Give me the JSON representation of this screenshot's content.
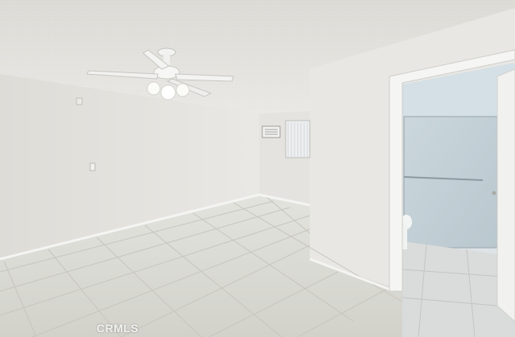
{
  "photo": {
    "subject": "empty room",
    "watermark_text": "CRMLS"
  },
  "colors": {
    "ceiling": "#e4e3de",
    "wall_left": "#e2e0db",
    "wall_right": "#e8e7e3",
    "floor_tile": "#d8d8d2",
    "grout": "#c4c3bc",
    "shower_glass": "#c9d5db",
    "baseboard": "#f4f4f2"
  }
}
